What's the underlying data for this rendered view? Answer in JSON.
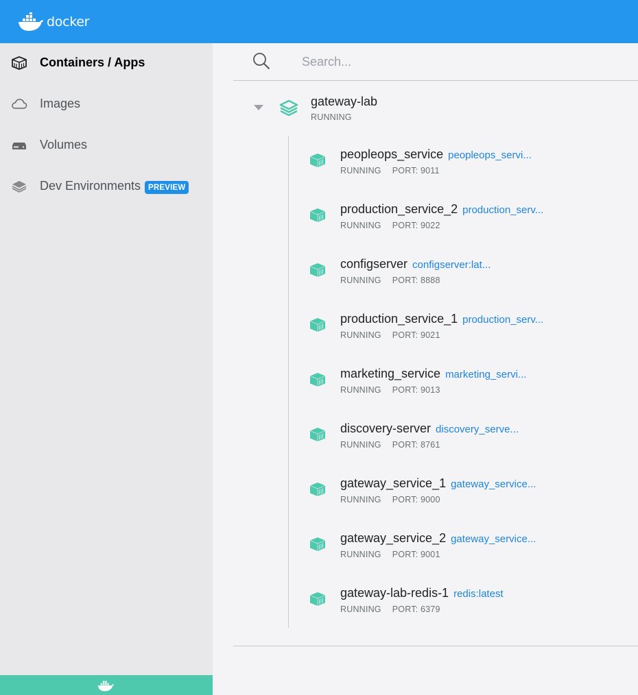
{
  "header": {
    "logo_text": "docker"
  },
  "sidebar": {
    "items": [
      {
        "label": "Containers / Apps",
        "icon": "container-box-icon",
        "active": true
      },
      {
        "label": "Images",
        "icon": "cloud-icon",
        "active": false
      },
      {
        "label": "Volumes",
        "icon": "volume-drive-icon",
        "active": false
      },
      {
        "label": "Dev Environments",
        "icon": "dev-environments-icon",
        "active": false,
        "badge": "PREVIEW"
      }
    ]
  },
  "search": {
    "placeholder": "Search..."
  },
  "app": {
    "name": "gateway-lab",
    "status": "RUNNING",
    "expanded": true,
    "containers": [
      {
        "name": "peopleops_service",
        "image": "peopleops_servi...",
        "status": "RUNNING",
        "port": "PORT: 9011"
      },
      {
        "name": "production_service_2",
        "image": "production_serv...",
        "status": "RUNNING",
        "port": "PORT: 9022"
      },
      {
        "name": "configserver",
        "image": "configserver:lat...",
        "status": "RUNNING",
        "port": "PORT: 8888"
      },
      {
        "name": "production_service_1",
        "image": "production_serv...",
        "status": "RUNNING",
        "port": "PORT: 9021"
      },
      {
        "name": "marketing_service",
        "image": "marketing_servi...",
        "status": "RUNNING",
        "port": "PORT: 9013"
      },
      {
        "name": "discovery-server",
        "image": "discovery_serve...",
        "status": "RUNNING",
        "port": "PORT: 8761"
      },
      {
        "name": "gateway_service_1",
        "image": "gateway_service...",
        "status": "RUNNING",
        "port": "PORT: 9000"
      },
      {
        "name": "gateway_service_2",
        "image": "gateway_service...",
        "status": "RUNNING",
        "port": "PORT: 9001"
      },
      {
        "name": "gateway-lab-redis-1",
        "image": "redis:latest",
        "status": "RUNNING",
        "port": "PORT: 6379"
      }
    ]
  },
  "colors": {
    "header_bg": "#2496ed",
    "accent_green": "#4ec9ad",
    "link_blue": "#1d84e0",
    "badge_blue": "#1d8fe8",
    "sidebar_bg": "#e8e8ea",
    "main_bg": "#f4f4f6"
  }
}
